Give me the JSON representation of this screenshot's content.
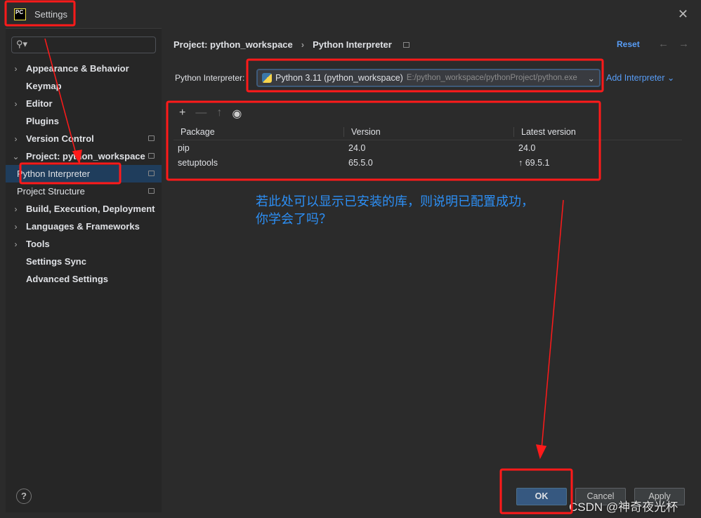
{
  "window": {
    "title": "Settings",
    "logo_text": "PC"
  },
  "sidebar": {
    "search_placeholder": "",
    "items": [
      {
        "label": "Appearance & Behavior",
        "chevron": ">"
      },
      {
        "label": "Keymap"
      },
      {
        "label": "Editor",
        "chevron": ">"
      },
      {
        "label": "Plugins"
      },
      {
        "label": "Version Control",
        "chevron": ">"
      },
      {
        "label": "Project: python_workspace",
        "chevron": "v"
      },
      {
        "label": "Python Interpreter"
      },
      {
        "label": "Project Structure"
      },
      {
        "label": "Build, Execution, Deployment",
        "chevron": ">"
      },
      {
        "label": "Languages & Frameworks",
        "chevron": ">"
      },
      {
        "label": "Tools",
        "chevron": ">"
      },
      {
        "label": "Settings Sync"
      },
      {
        "label": "Advanced Settings"
      }
    ]
  },
  "breadcrumb": {
    "project": "Project: python_workspace",
    "sep": "›",
    "page": "Python Interpreter"
  },
  "header": {
    "reset": "Reset",
    "back": "←",
    "forward": "→"
  },
  "interpreter": {
    "label": "Python Interpreter:",
    "name": "Python 3.11 (python_workspace)",
    "path": "E:/python_workspace/pythonProject/python.exe",
    "add": "Add Interpreter"
  },
  "packages": {
    "columns": [
      "Package",
      "Version",
      "Latest version"
    ],
    "rows": [
      {
        "package": "pip",
        "version": "24.0",
        "latest": "24.0"
      },
      {
        "package": "setuptools",
        "version": "65.5.0",
        "latest": "↑ 69.5.1"
      }
    ]
  },
  "annotation": "若此处可以显示已安装的库，则说明已配置成功，你学会了吗？",
  "footer": {
    "help": "?",
    "ok": "OK",
    "cancel": "Cancel",
    "apply": "Apply"
  },
  "watermark": "CSDN @神奇夜光杯"
}
